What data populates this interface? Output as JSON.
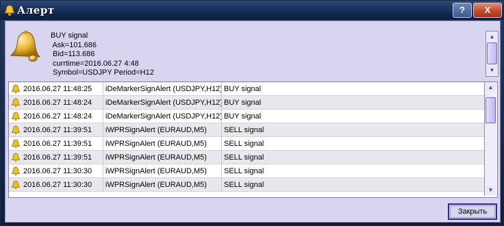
{
  "window": {
    "title": "Алерт",
    "help_label": "?",
    "close_label": "X"
  },
  "alert": {
    "lines": [
      "BUY signal",
      " Ask=101.686",
      " Bid=113.686",
      " currtime=2016.06.27 4:48",
      " Symbol=USDJPY Period=H12"
    ]
  },
  "rows": [
    {
      "time": "2016.06.27 11:48:25",
      "source": "iDeMarkerSignAlert (USDJPY,H12)",
      "message": "BUY signal"
    },
    {
      "time": "2016.06.27 11:48:24",
      "source": "iDeMarkerSignAlert (USDJPY,H12)",
      "message": "BUY signal"
    },
    {
      "time": "2016.06.27 11:48:24",
      "source": "iDeMarkerSignAlert (USDJPY,H12)",
      "message": "BUY signal"
    },
    {
      "time": "2016.06.27 11:39:51",
      "source": "iWPRSignAlert (EURAUD,M5)",
      "message": "SELL signal"
    },
    {
      "time": "2016.06.27 11:39:51",
      "source": "iWPRSignAlert (EURAUD,M5)",
      "message": "SELL signal"
    },
    {
      "time": "2016.06.27 11:39:51",
      "source": "iWPRSignAlert (EURAUD,M5)",
      "message": "SELL signal"
    },
    {
      "time": "2016.06.27 11:30:30",
      "source": "iWPRSignAlert (EURAUD,M5)",
      "message": "SELL signal"
    },
    {
      "time": "2016.06.27 11:30:30",
      "source": "iWPRSignAlert (EURAUD,M5)",
      "message": "SELL signal"
    }
  ],
  "buttons": {
    "close": "Закрыть"
  },
  "icons": {
    "alert": "bell-icon",
    "row": "bell-icon"
  },
  "colors": {
    "client_bg": "#d9d4f0",
    "accent": "#2e2ba0"
  }
}
